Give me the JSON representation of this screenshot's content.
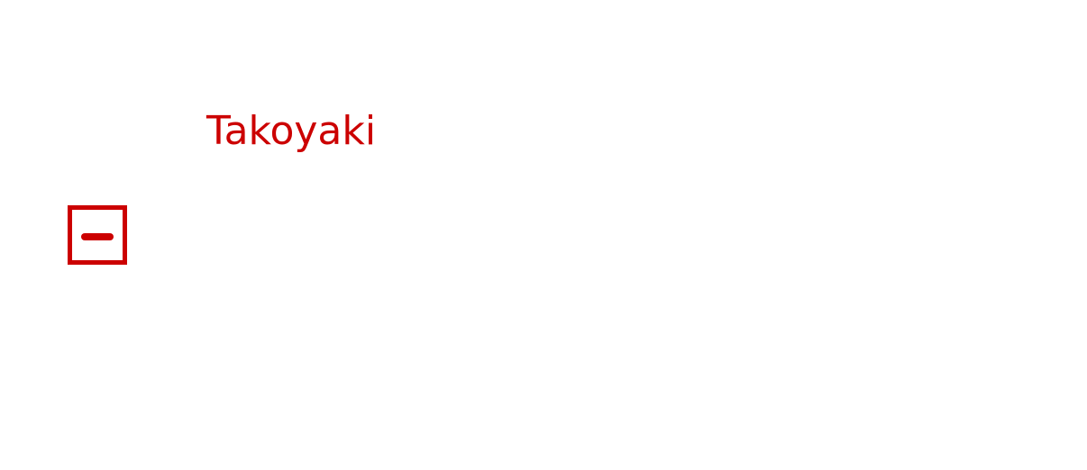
{
  "item": {
    "title": "Takoyaki",
    "collapse_icon": "minus-square-icon",
    "accent_color": "#cc0000"
  }
}
